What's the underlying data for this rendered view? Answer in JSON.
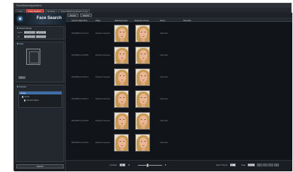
{
  "window": {
    "title": "FaceSearchApplication"
  },
  "tabs": [
    {
      "label": "Live"
    },
    {
      "label": "Face Search"
    },
    {
      "label": "Settings"
    },
    {
      "label": "Face Matching Report / Log"
    }
  ],
  "sidebar": {
    "brand_title": "Face Search",
    "time_section": {
      "header": "Search Range",
      "from_label": "From",
      "from_date": "2013/01/01",
      "from_time": "00:00:00",
      "to_label": "To",
      "to_date": "2013/12/31",
      "to_time": "23:59:59"
    },
    "face_section": {
      "header": "Face",
      "select_button": "Select"
    },
    "camera_section": {
      "header": "Camera",
      "selected": "Group",
      "items": [
        {
          "label": "Group"
        },
        {
          "label": "Camera Select"
        }
      ]
    },
    "search_button": "Search"
  },
  "toolbar": {
    "buttons": [
      {
        "label": "Export"
      },
      {
        "label": "Search"
      }
    ]
  },
  "grid": {
    "columns": [
      "Search Date/Time",
      "Place",
      "Matching Face",
      "Registered Face",
      "Name",
      "Remarks"
    ],
    "rows": [
      {
        "datetime": "2013/05/14 14:21:13",
        "place": "Entrance Camera",
        "name": "Jane Doe"
      },
      {
        "datetime": "2013/05/14 14:20:58",
        "place": "Entrance Camera",
        "name": "Jane Doe"
      },
      {
        "datetime": "2013/05/14 14:20:41",
        "place": "Entrance Camera",
        "name": "Jane Doe"
      },
      {
        "datetime": "2013/05/14 14:20:27",
        "place": "Entrance Camera",
        "name": "Jane Doe"
      },
      {
        "datetime": "2013/05/14 14:20:09",
        "place": "Entrance Camera",
        "name": "Jane Doe"
      },
      {
        "datetime": "2013/05/14 14:19:52",
        "place": "Entrance Camera",
        "name": "Jane Doe"
      }
    ]
  },
  "bottom": {
    "threshold_label": "Similarity",
    "threshold_value": "50",
    "slider_level": 0.4,
    "result_label": "Search Result",
    "result_value": "6",
    "page_label": "Page",
    "page_value": "1 / 1",
    "first_btn": "|<",
    "prev_btn": "<",
    "next_btn": ">",
    "last_btn": ">|"
  },
  "colors": {
    "accent": "#c4403a",
    "selection": "#3f6fa8",
    "background": "#15181c"
  }
}
